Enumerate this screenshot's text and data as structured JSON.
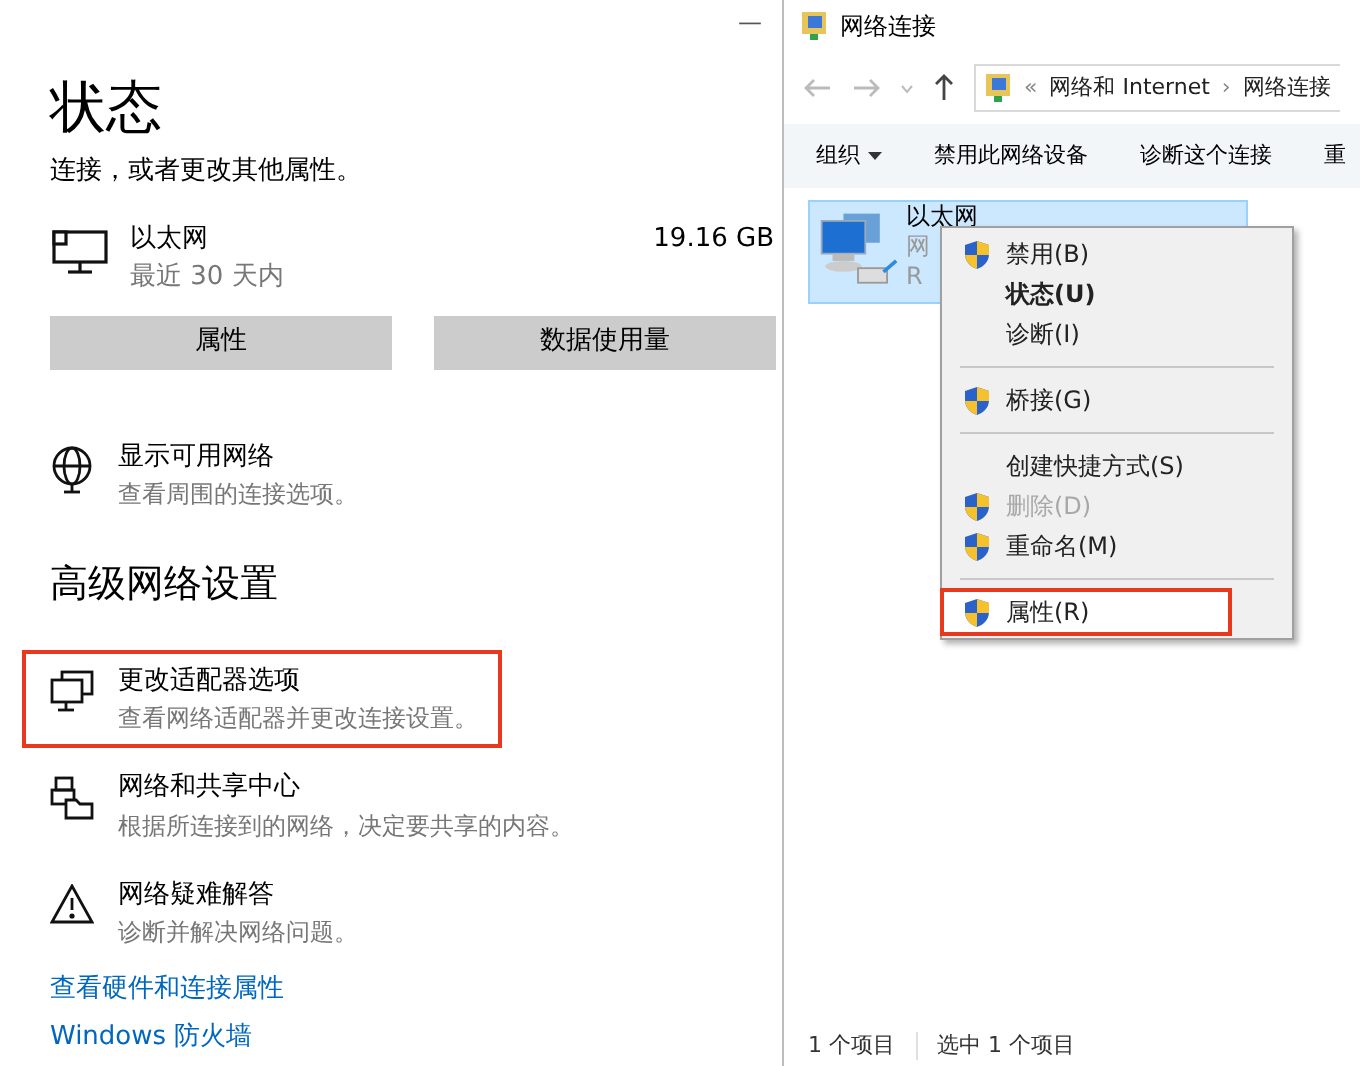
{
  "settings": {
    "minimize": "—",
    "title": "状态",
    "subtitle": "连接，或者更改其他属性。",
    "connection": {
      "name": "以太网",
      "period": "最近 30 天内",
      "usage": "19.16 GB"
    },
    "buttons": [
      "属性",
      "数据使用量"
    ],
    "show_networks": {
      "title": "显示可用网络",
      "desc": "查看周围的连接选项。"
    },
    "section": "高级网络设置",
    "options": [
      {
        "title": "更改适配器选项",
        "desc": "查看网络适配器并更改连接设置。",
        "annotated": true
      },
      {
        "title": "网络和共享中心",
        "desc": "根据所连接到的网络，决定要共享的内容。",
        "annotated": false
      },
      {
        "title": "网络疑难解答",
        "desc": "诊断并解决网络问题。",
        "annotated": false
      }
    ],
    "links": [
      "查看硬件和连接属性",
      "Windows 防火墙"
    ]
  },
  "explorer": {
    "title": "网络连接",
    "breadcrumb": [
      "«",
      "网络和 Internet",
      "›",
      "网络连接"
    ],
    "toolbar": [
      {
        "label": "组织",
        "dropdown": true
      },
      {
        "label": "禁用此网络设备",
        "dropdown": false
      },
      {
        "label": "诊断这个连接",
        "dropdown": false
      },
      {
        "label": "重",
        "dropdown": false
      }
    ],
    "item": {
      "name": "以太网",
      "line_2": "网",
      "line_3": "R",
      "selected": true
    },
    "context_menu": [
      {
        "kind": "item",
        "label": "禁用(B)",
        "shield": true,
        "bold": false,
        "disabled": false,
        "annotated": false
      },
      {
        "kind": "item",
        "label": "状态(U)",
        "shield": false,
        "bold": true,
        "disabled": false,
        "annotated": false
      },
      {
        "kind": "item",
        "label": "诊断(I)",
        "shield": false,
        "bold": false,
        "disabled": false,
        "annotated": false
      },
      {
        "kind": "separator"
      },
      {
        "kind": "item",
        "label": "桥接(G)",
        "shield": true,
        "bold": false,
        "disabled": false,
        "annotated": false
      },
      {
        "kind": "separator"
      },
      {
        "kind": "item",
        "label": "创建快捷方式(S)",
        "shield": false,
        "bold": false,
        "disabled": false,
        "annotated": false
      },
      {
        "kind": "item",
        "label": "删除(D)",
        "shield": true,
        "bold": false,
        "disabled": true,
        "annotated": false
      },
      {
        "kind": "item",
        "label": "重命名(M)",
        "shield": true,
        "bold": false,
        "disabled": false,
        "annotated": false
      },
      {
        "kind": "separator"
      },
      {
        "kind": "item",
        "label": "属性(R)",
        "shield": true,
        "bold": false,
        "disabled": false,
        "annotated": true
      }
    ],
    "status": [
      "1 个项目",
      "选中 1 个项目"
    ]
  }
}
